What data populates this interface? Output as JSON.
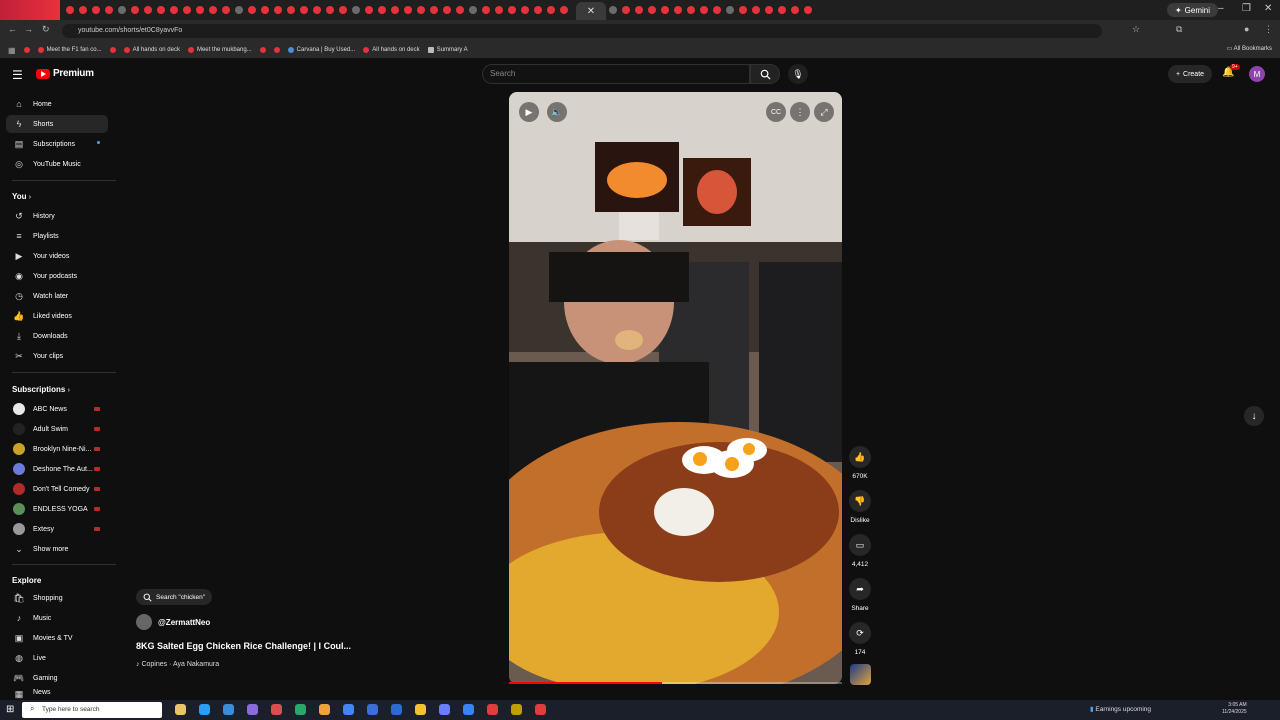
{
  "browser": {
    "url": "youtube.com/shorts/et0C8yavvFo",
    "gemini_label": "Gemini",
    "all_bookmarks_label": "All Bookmarks",
    "bookmarks": [
      "Meet the F1 fan co...",
      "All hands on deck",
      "Meet the mukbang...",
      "Carvana | Buy Used...",
      "All hands on deck",
      "Summary A"
    ]
  },
  "header": {
    "logo_text": "Premium",
    "search_placeholder": "Search",
    "create_label": "Create",
    "notification_badge": "9+",
    "avatar_letter": "M"
  },
  "sidebar": {
    "main": [
      {
        "label": "Home",
        "icon": "home-icon"
      },
      {
        "label": "Shorts",
        "icon": "shorts-icon"
      },
      {
        "label": "Subscriptions",
        "icon": "subscriptions-icon"
      },
      {
        "label": "YouTube Music",
        "icon": "music-icon"
      }
    ],
    "you_heading": "You",
    "you": [
      {
        "label": "History",
        "icon": "history-icon"
      },
      {
        "label": "Playlists",
        "icon": "playlists-icon"
      },
      {
        "label": "Your videos",
        "icon": "your-videos-icon"
      },
      {
        "label": "Your podcasts",
        "icon": "podcasts-icon"
      },
      {
        "label": "Watch later",
        "icon": "clock-icon"
      },
      {
        "label": "Liked videos",
        "icon": "thumbs-up-icon"
      },
      {
        "label": "Downloads",
        "icon": "download-icon"
      },
      {
        "label": "Your clips",
        "icon": "scissors-icon"
      }
    ],
    "subscriptions_heading": "Subscriptions",
    "subscriptions": [
      {
        "label": "ABC News",
        "color": "#e8e8e8"
      },
      {
        "label": "Adult Swim",
        "color": "#222222"
      },
      {
        "label": "Brooklyn Nine-Ni...",
        "color": "#c9a227"
      },
      {
        "label": "Deshone The Aut...",
        "color": "#6c7bd9"
      },
      {
        "label": "Don't Tell Comedy",
        "color": "#b02a2a"
      },
      {
        "label": "ENDLESS YOGA",
        "color": "#5a8f5a"
      },
      {
        "label": "Extesy",
        "color": "#999999"
      }
    ],
    "show_more": "Show more",
    "explore_heading": "Explore",
    "explore": [
      {
        "label": "Shopping",
        "icon": "shopping-icon"
      },
      {
        "label": "Music",
        "icon": "music-note-icon"
      },
      {
        "label": "Movies & TV",
        "icon": "movies-icon"
      },
      {
        "label": "Live",
        "icon": "live-icon"
      },
      {
        "label": "Gaming",
        "icon": "gaming-icon"
      },
      {
        "label": "News",
        "icon": "news-icon"
      }
    ]
  },
  "short": {
    "search_chip": "Search \"chicken\"",
    "channel": "@ZermattNeo",
    "title": "8KG Salted Egg Chicken Rice Challenge! | I Coul...",
    "music": "Copines · Aya Nakamura",
    "progress": 0.46
  },
  "actions": {
    "likes": "670K",
    "dislike": "Dislike",
    "comments": "4,412",
    "share": "Share",
    "remix": "174"
  },
  "taskbar": {
    "search_placeholder": "Type here to search",
    "earnings": "Earnings upcoming",
    "time": "3:05 AM",
    "date": "11/24/2025"
  }
}
